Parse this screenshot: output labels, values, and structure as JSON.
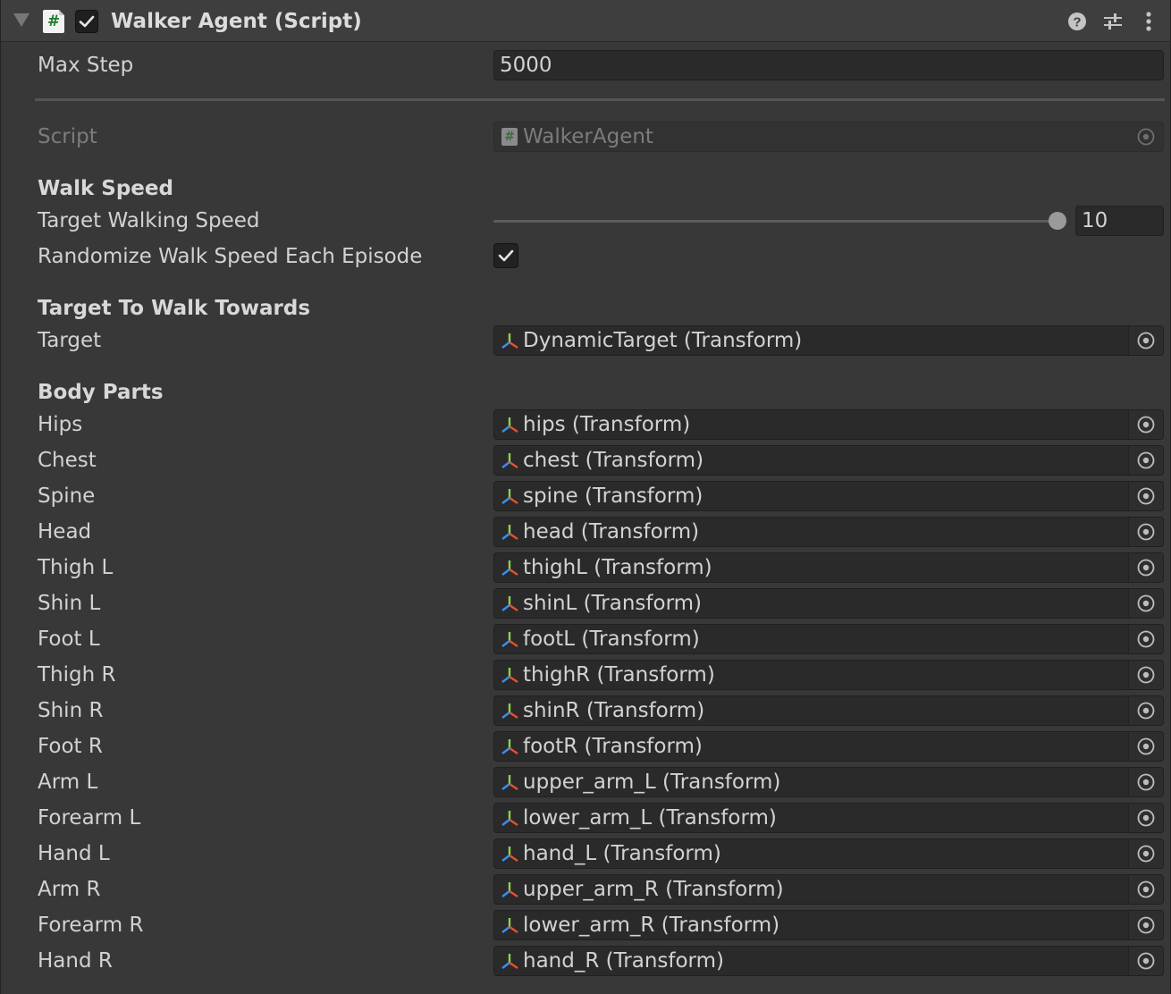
{
  "component": {
    "title": "Walker Agent (Script)",
    "enabled": true
  },
  "max_step": {
    "label": "Max Step",
    "value": "5000"
  },
  "script": {
    "label": "Script",
    "value": "WalkerAgent"
  },
  "walk_speed": {
    "section_label": "Walk Speed",
    "target_walking_speed": {
      "label": "Target Walking Speed",
      "value": "10",
      "slider_fraction": 1.0
    },
    "randomize": {
      "label": "Randomize Walk Speed Each Episode",
      "checked": true
    }
  },
  "target_section": {
    "section_label": "Target To Walk Towards",
    "target": {
      "label": "Target",
      "value": "DynamicTarget (Transform)"
    }
  },
  "body_parts": {
    "section_label": "Body Parts",
    "items": [
      {
        "label": "Hips",
        "value": "hips (Transform)"
      },
      {
        "label": "Chest",
        "value": "chest (Transform)"
      },
      {
        "label": "Spine",
        "value": "spine (Transform)"
      },
      {
        "label": "Head",
        "value": "head (Transform)"
      },
      {
        "label": "Thigh L",
        "value": "thighL (Transform)"
      },
      {
        "label": "Shin L",
        "value": "shinL (Transform)"
      },
      {
        "label": "Foot L",
        "value": "footL (Transform)"
      },
      {
        "label": "Thigh R",
        "value": "thighR (Transform)"
      },
      {
        "label": "Shin R",
        "value": "shinR (Transform)"
      },
      {
        "label": "Foot R",
        "value": "footR (Transform)"
      },
      {
        "label": "Arm L",
        "value": "upper_arm_L (Transform)"
      },
      {
        "label": "Forearm L",
        "value": "lower_arm_L (Transform)"
      },
      {
        "label": "Hand L",
        "value": "hand_L (Transform)"
      },
      {
        "label": "Arm R",
        "value": "upper_arm_R (Transform)"
      },
      {
        "label": "Forearm R",
        "value": "lower_arm_R (Transform)"
      },
      {
        "label": "Hand R",
        "value": "hand_R (Transform)"
      }
    ]
  },
  "icons": {
    "foldout": "triangle-down-icon",
    "script": "csharp-script-icon",
    "toggle": "checkmark-icon",
    "help": "help-icon",
    "preset": "preset-sliders-icon",
    "menu": "kebab-menu-icon",
    "transform": "transform-axes-icon",
    "object_picker": "object-picker-icon"
  },
  "colors": {
    "background": "#383838",
    "header": "#3e3e3e",
    "field": "#2a2a2a",
    "text": "#d2d2d2",
    "disabled_text": "#7c7c7c",
    "script_hash": "#1e7b2e"
  }
}
